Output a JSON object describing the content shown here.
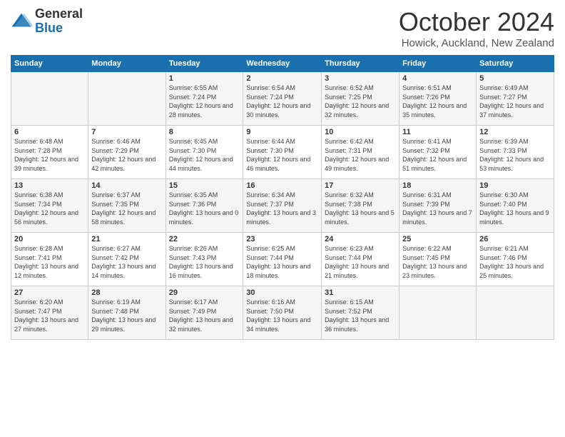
{
  "logo": {
    "general": "General",
    "blue": "Blue"
  },
  "header": {
    "title": "October 2024",
    "location": "Howick, Auckland, New Zealand"
  },
  "weekdays": [
    "Sunday",
    "Monday",
    "Tuesday",
    "Wednesday",
    "Thursday",
    "Friday",
    "Saturday"
  ],
  "weeks": [
    [
      {
        "day": "",
        "sunrise": "",
        "sunset": "",
        "daylight": ""
      },
      {
        "day": "",
        "sunrise": "",
        "sunset": "",
        "daylight": ""
      },
      {
        "day": "1",
        "sunrise": "Sunrise: 6:55 AM",
        "sunset": "Sunset: 7:24 PM",
        "daylight": "Daylight: 12 hours and 28 minutes."
      },
      {
        "day": "2",
        "sunrise": "Sunrise: 6:54 AM",
        "sunset": "Sunset: 7:24 PM",
        "daylight": "Daylight: 12 hours and 30 minutes."
      },
      {
        "day": "3",
        "sunrise": "Sunrise: 6:52 AM",
        "sunset": "Sunset: 7:25 PM",
        "daylight": "Daylight: 12 hours and 32 minutes."
      },
      {
        "day": "4",
        "sunrise": "Sunrise: 6:51 AM",
        "sunset": "Sunset: 7:26 PM",
        "daylight": "Daylight: 12 hours and 35 minutes."
      },
      {
        "day": "5",
        "sunrise": "Sunrise: 6:49 AM",
        "sunset": "Sunset: 7:27 PM",
        "daylight": "Daylight: 12 hours and 37 minutes."
      }
    ],
    [
      {
        "day": "6",
        "sunrise": "Sunrise: 6:48 AM",
        "sunset": "Sunset: 7:28 PM",
        "daylight": "Daylight: 12 hours and 39 minutes."
      },
      {
        "day": "7",
        "sunrise": "Sunrise: 6:46 AM",
        "sunset": "Sunset: 7:29 PM",
        "daylight": "Daylight: 12 hours and 42 minutes."
      },
      {
        "day": "8",
        "sunrise": "Sunrise: 6:45 AM",
        "sunset": "Sunset: 7:30 PM",
        "daylight": "Daylight: 12 hours and 44 minutes."
      },
      {
        "day": "9",
        "sunrise": "Sunrise: 6:44 AM",
        "sunset": "Sunset: 7:30 PM",
        "daylight": "Daylight: 12 hours and 46 minutes."
      },
      {
        "day": "10",
        "sunrise": "Sunrise: 6:42 AM",
        "sunset": "Sunset: 7:31 PM",
        "daylight": "Daylight: 12 hours and 49 minutes."
      },
      {
        "day": "11",
        "sunrise": "Sunrise: 6:41 AM",
        "sunset": "Sunset: 7:32 PM",
        "daylight": "Daylight: 12 hours and 51 minutes."
      },
      {
        "day": "12",
        "sunrise": "Sunrise: 6:39 AM",
        "sunset": "Sunset: 7:33 PM",
        "daylight": "Daylight: 12 hours and 53 minutes."
      }
    ],
    [
      {
        "day": "13",
        "sunrise": "Sunrise: 6:38 AM",
        "sunset": "Sunset: 7:34 PM",
        "daylight": "Daylight: 12 hours and 56 minutes."
      },
      {
        "day": "14",
        "sunrise": "Sunrise: 6:37 AM",
        "sunset": "Sunset: 7:35 PM",
        "daylight": "Daylight: 12 hours and 58 minutes."
      },
      {
        "day": "15",
        "sunrise": "Sunrise: 6:35 AM",
        "sunset": "Sunset: 7:36 PM",
        "daylight": "Daylight: 13 hours and 0 minutes."
      },
      {
        "day": "16",
        "sunrise": "Sunrise: 6:34 AM",
        "sunset": "Sunset: 7:37 PM",
        "daylight": "Daylight: 13 hours and 3 minutes."
      },
      {
        "day": "17",
        "sunrise": "Sunrise: 6:32 AM",
        "sunset": "Sunset: 7:38 PM",
        "daylight": "Daylight: 13 hours and 5 minutes."
      },
      {
        "day": "18",
        "sunrise": "Sunrise: 6:31 AM",
        "sunset": "Sunset: 7:39 PM",
        "daylight": "Daylight: 13 hours and 7 minutes."
      },
      {
        "day": "19",
        "sunrise": "Sunrise: 6:30 AM",
        "sunset": "Sunset: 7:40 PM",
        "daylight": "Daylight: 13 hours and 9 minutes."
      }
    ],
    [
      {
        "day": "20",
        "sunrise": "Sunrise: 6:28 AM",
        "sunset": "Sunset: 7:41 PM",
        "daylight": "Daylight: 13 hours and 12 minutes."
      },
      {
        "day": "21",
        "sunrise": "Sunrise: 6:27 AM",
        "sunset": "Sunset: 7:42 PM",
        "daylight": "Daylight: 13 hours and 14 minutes."
      },
      {
        "day": "22",
        "sunrise": "Sunrise: 6:26 AM",
        "sunset": "Sunset: 7:43 PM",
        "daylight": "Daylight: 13 hours and 16 minutes."
      },
      {
        "day": "23",
        "sunrise": "Sunrise: 6:25 AM",
        "sunset": "Sunset: 7:44 PM",
        "daylight": "Daylight: 13 hours and 18 minutes."
      },
      {
        "day": "24",
        "sunrise": "Sunrise: 6:23 AM",
        "sunset": "Sunset: 7:44 PM",
        "daylight": "Daylight: 13 hours and 21 minutes."
      },
      {
        "day": "25",
        "sunrise": "Sunrise: 6:22 AM",
        "sunset": "Sunset: 7:45 PM",
        "daylight": "Daylight: 13 hours and 23 minutes."
      },
      {
        "day": "26",
        "sunrise": "Sunrise: 6:21 AM",
        "sunset": "Sunset: 7:46 PM",
        "daylight": "Daylight: 13 hours and 25 minutes."
      }
    ],
    [
      {
        "day": "27",
        "sunrise": "Sunrise: 6:20 AM",
        "sunset": "Sunset: 7:47 PM",
        "daylight": "Daylight: 13 hours and 27 minutes."
      },
      {
        "day": "28",
        "sunrise": "Sunrise: 6:19 AM",
        "sunset": "Sunset: 7:48 PM",
        "daylight": "Daylight: 13 hours and 29 minutes."
      },
      {
        "day": "29",
        "sunrise": "Sunrise: 6:17 AM",
        "sunset": "Sunset: 7:49 PM",
        "daylight": "Daylight: 13 hours and 32 minutes."
      },
      {
        "day": "30",
        "sunrise": "Sunrise: 6:16 AM",
        "sunset": "Sunset: 7:50 PM",
        "daylight": "Daylight: 13 hours and 34 minutes."
      },
      {
        "day": "31",
        "sunrise": "Sunrise: 6:15 AM",
        "sunset": "Sunset: 7:52 PM",
        "daylight": "Daylight: 13 hours and 36 minutes."
      },
      {
        "day": "",
        "sunrise": "",
        "sunset": "",
        "daylight": ""
      },
      {
        "day": "",
        "sunrise": "",
        "sunset": "",
        "daylight": ""
      }
    ]
  ]
}
